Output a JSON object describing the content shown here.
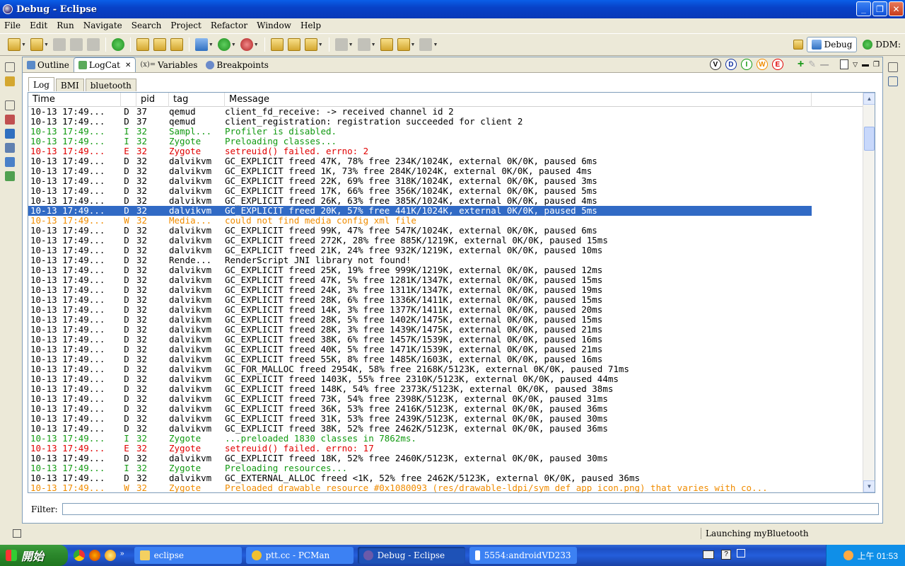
{
  "window": {
    "title": "Debug - Eclipse"
  },
  "menu": [
    "File",
    "Edit",
    "Run",
    "Navigate",
    "Search",
    "Project",
    "Refactor",
    "Window",
    "Help"
  ],
  "perspectives": {
    "debug": "Debug",
    "ddms": "DDM:"
  },
  "view_tabs": [
    {
      "label": "Outline",
      "active": false
    },
    {
      "label": "LogCat",
      "active": true
    },
    {
      "label": "Variables",
      "active": false
    },
    {
      "label": "Breakpoints",
      "active": false
    }
  ],
  "log_levels": [
    "V",
    "D",
    "I",
    "W",
    "E"
  ],
  "sub_tabs": [
    "Log",
    "BMI",
    "bluetooth"
  ],
  "columns": {
    "time": "Time",
    "pid": "pid",
    "tag": "tag",
    "message": "Message"
  },
  "rows": [
    {
      "time": "10-13 17:49...",
      "level": "D",
      "pid": "37",
      "tag": "qemud",
      "message": "client_fd_receive:    -> received channel id 2"
    },
    {
      "time": "10-13 17:49...",
      "level": "D",
      "pid": "37",
      "tag": "qemud",
      "message": "client_registration: registration succeeded for client 2"
    },
    {
      "time": "10-13 17:49...",
      "level": "I",
      "pid": "32",
      "tag": "Sampl...",
      "message": "Profiler is disabled."
    },
    {
      "time": "10-13 17:49...",
      "level": "I",
      "pid": "32",
      "tag": "Zygote",
      "message": "Preloading classes..."
    },
    {
      "time": "10-13 17:49...",
      "level": "E",
      "pid": "32",
      "tag": "Zygote",
      "message": "setreuid() failed. errno: 2"
    },
    {
      "time": "10-13 17:49...",
      "level": "D",
      "pid": "32",
      "tag": "dalvikvm",
      "message": "GC_EXPLICIT freed 47K, 78% free 234K/1024K, external 0K/0K, paused 6ms"
    },
    {
      "time": "10-13 17:49...",
      "level": "D",
      "pid": "32",
      "tag": "dalvikvm",
      "message": "GC_EXPLICIT freed 1K, 73% free 284K/1024K, external 0K/0K, paused 4ms"
    },
    {
      "time": "10-13 17:49...",
      "level": "D",
      "pid": "32",
      "tag": "dalvikvm",
      "message": "GC_EXPLICIT freed 22K, 69% free 318K/1024K, external 0K/0K, paused 3ms"
    },
    {
      "time": "10-13 17:49...",
      "level": "D",
      "pid": "32",
      "tag": "dalvikvm",
      "message": "GC_EXPLICIT freed 17K, 66% free 356K/1024K, external 0K/0K, paused 5ms"
    },
    {
      "time": "10-13 17:49...",
      "level": "D",
      "pid": "32",
      "tag": "dalvikvm",
      "message": "GC_EXPLICIT freed 26K, 63% free 385K/1024K, external 0K/0K, paused 4ms"
    },
    {
      "time": "10-13 17:49...",
      "level": "D",
      "pid": "32",
      "tag": "dalvikvm",
      "message": "GC_EXPLICIT freed 20K, 57% free 441K/1024K, external 0K/0K, paused 5ms",
      "selected": true
    },
    {
      "time": "10-13 17:49...",
      "level": "W",
      "pid": "32",
      "tag": "Media...",
      "message": "could not find media config xml file"
    },
    {
      "time": "10-13 17:49...",
      "level": "D",
      "pid": "32",
      "tag": "dalvikvm",
      "message": "GC_EXPLICIT freed 99K, 47% free 547K/1024K, external 0K/0K, paused 6ms"
    },
    {
      "time": "10-13 17:49...",
      "level": "D",
      "pid": "32",
      "tag": "dalvikvm",
      "message": "GC_EXPLICIT freed 272K, 28% free 885K/1219K, external 0K/0K, paused 15ms"
    },
    {
      "time": "10-13 17:49...",
      "level": "D",
      "pid": "32",
      "tag": "dalvikvm",
      "message": "GC_EXPLICIT freed 21K, 24% free 932K/1219K, external 0K/0K, paused 10ms"
    },
    {
      "time": "10-13 17:49...",
      "level": "D",
      "pid": "32",
      "tag": "Rende...",
      "message": "RenderScript JNI library not found!"
    },
    {
      "time": "10-13 17:49...",
      "level": "D",
      "pid": "32",
      "tag": "dalvikvm",
      "message": "GC_EXPLICIT freed 25K, 19% free 999K/1219K, external 0K/0K, paused 12ms"
    },
    {
      "time": "10-13 17:49...",
      "level": "D",
      "pid": "32",
      "tag": "dalvikvm",
      "message": "GC_EXPLICIT freed 47K, 5% free 1281K/1347K, external 0K/0K, paused 15ms"
    },
    {
      "time": "10-13 17:49...",
      "level": "D",
      "pid": "32",
      "tag": "dalvikvm",
      "message": "GC_EXPLICIT freed 24K, 3% free 1311K/1347K, external 0K/0K, paused 19ms"
    },
    {
      "time": "10-13 17:49...",
      "level": "D",
      "pid": "32",
      "tag": "dalvikvm",
      "message": "GC_EXPLICIT freed 28K, 6% free 1336K/1411K, external 0K/0K, paused 15ms"
    },
    {
      "time": "10-13 17:49...",
      "level": "D",
      "pid": "32",
      "tag": "dalvikvm",
      "message": "GC_EXPLICIT freed 14K, 3% free 1377K/1411K, external 0K/0K, paused 20ms"
    },
    {
      "time": "10-13 17:49...",
      "level": "D",
      "pid": "32",
      "tag": "dalvikvm",
      "message": "GC_EXPLICIT freed 28K, 5% free 1402K/1475K, external 0K/0K, paused 15ms"
    },
    {
      "time": "10-13 17:49...",
      "level": "D",
      "pid": "32",
      "tag": "dalvikvm",
      "message": "GC_EXPLICIT freed 28K, 3% free 1439K/1475K, external 0K/0K, paused 21ms"
    },
    {
      "time": "10-13 17:49...",
      "level": "D",
      "pid": "32",
      "tag": "dalvikvm",
      "message": "GC_EXPLICIT freed 38K, 6% free 1457K/1539K, external 0K/0K, paused 16ms"
    },
    {
      "time": "10-13 17:49...",
      "level": "D",
      "pid": "32",
      "tag": "dalvikvm",
      "message": "GC_EXPLICIT freed 40K, 5% free 1471K/1539K, external 0K/0K, paused 21ms"
    },
    {
      "time": "10-13 17:49...",
      "level": "D",
      "pid": "32",
      "tag": "dalvikvm",
      "message": "GC_EXPLICIT freed 55K, 8% free 1485K/1603K, external 0K/0K, paused 16ms"
    },
    {
      "time": "10-13 17:49...",
      "level": "D",
      "pid": "32",
      "tag": "dalvikvm",
      "message": "GC_FOR_MALLOC freed 2954K, 58% free 2168K/5123K, external 0K/0K, paused 71ms"
    },
    {
      "time": "10-13 17:49...",
      "level": "D",
      "pid": "32",
      "tag": "dalvikvm",
      "message": "GC_EXPLICIT freed 1403K, 55% free 2310K/5123K, external 0K/0K, paused 44ms"
    },
    {
      "time": "10-13 17:49...",
      "level": "D",
      "pid": "32",
      "tag": "dalvikvm",
      "message": "GC_EXPLICIT freed 148K, 54% free 2373K/5123K, external 0K/0K, paused 38ms"
    },
    {
      "time": "10-13 17:49...",
      "level": "D",
      "pid": "32",
      "tag": "dalvikvm",
      "message": "GC_EXPLICIT freed 73K, 54% free 2398K/5123K, external 0K/0K, paused 31ms"
    },
    {
      "time": "10-13 17:49...",
      "level": "D",
      "pid": "32",
      "tag": "dalvikvm",
      "message": "GC_EXPLICIT freed 36K, 53% free 2416K/5123K, external 0K/0K, paused 36ms"
    },
    {
      "time": "10-13 17:49...",
      "level": "D",
      "pid": "32",
      "tag": "dalvikvm",
      "message": "GC_EXPLICIT freed 31K, 53% free 2439K/5123K, external 0K/0K, paused 30ms"
    },
    {
      "time": "10-13 17:49...",
      "level": "D",
      "pid": "32",
      "tag": "dalvikvm",
      "message": "GC_EXPLICIT freed 38K, 52% free 2462K/5123K, external 0K/0K, paused 36ms"
    },
    {
      "time": "10-13 17:49...",
      "level": "I",
      "pid": "32",
      "tag": "Zygote",
      "message": "...preloaded 1830 classes in 7862ms."
    },
    {
      "time": "10-13 17:49...",
      "level": "E",
      "pid": "32",
      "tag": "Zygote",
      "message": "setreuid() failed. errno: 17"
    },
    {
      "time": "10-13 17:49...",
      "level": "D",
      "pid": "32",
      "tag": "dalvikvm",
      "message": "GC_EXPLICIT freed 18K, 52% free 2460K/5123K, external 0K/0K, paused 30ms"
    },
    {
      "time": "10-13 17:49...",
      "level": "I",
      "pid": "32",
      "tag": "Zygote",
      "message": "Preloading resources..."
    },
    {
      "time": "10-13 17:49...",
      "level": "D",
      "pid": "32",
      "tag": "dalvikvm",
      "message": "GC_EXTERNAL_ALLOC freed <1K, 52% free 2462K/5123K, external 0K/0K, paused 36ms"
    },
    {
      "time": "10-13 17:49...",
      "level": "W",
      "pid": "32",
      "tag": "Zygote",
      "message": "Preloaded drawable resource #0x1080093 (res/drawable-ldpi/sym_def_app_icon.png) that varies with co..."
    }
  ],
  "filter": {
    "label": "Filter:",
    "value": ""
  },
  "status": {
    "message": "Launching myBluetooth"
  },
  "taskbar": {
    "start": "開始",
    "tasks": [
      {
        "label": "eclipse",
        "active": false
      },
      {
        "label": "ptt.cc - PCMan",
        "active": false
      },
      {
        "label": "Debug - Eclipse",
        "active": true
      },
      {
        "label": "5554:androidVD233",
        "active": false
      }
    ],
    "clock": "上午 01:53"
  },
  "colors": {
    "debug": "#000000",
    "info": "#119911",
    "error": "#e00000",
    "warn": "#f08c00",
    "selection": "#316ac5"
  }
}
